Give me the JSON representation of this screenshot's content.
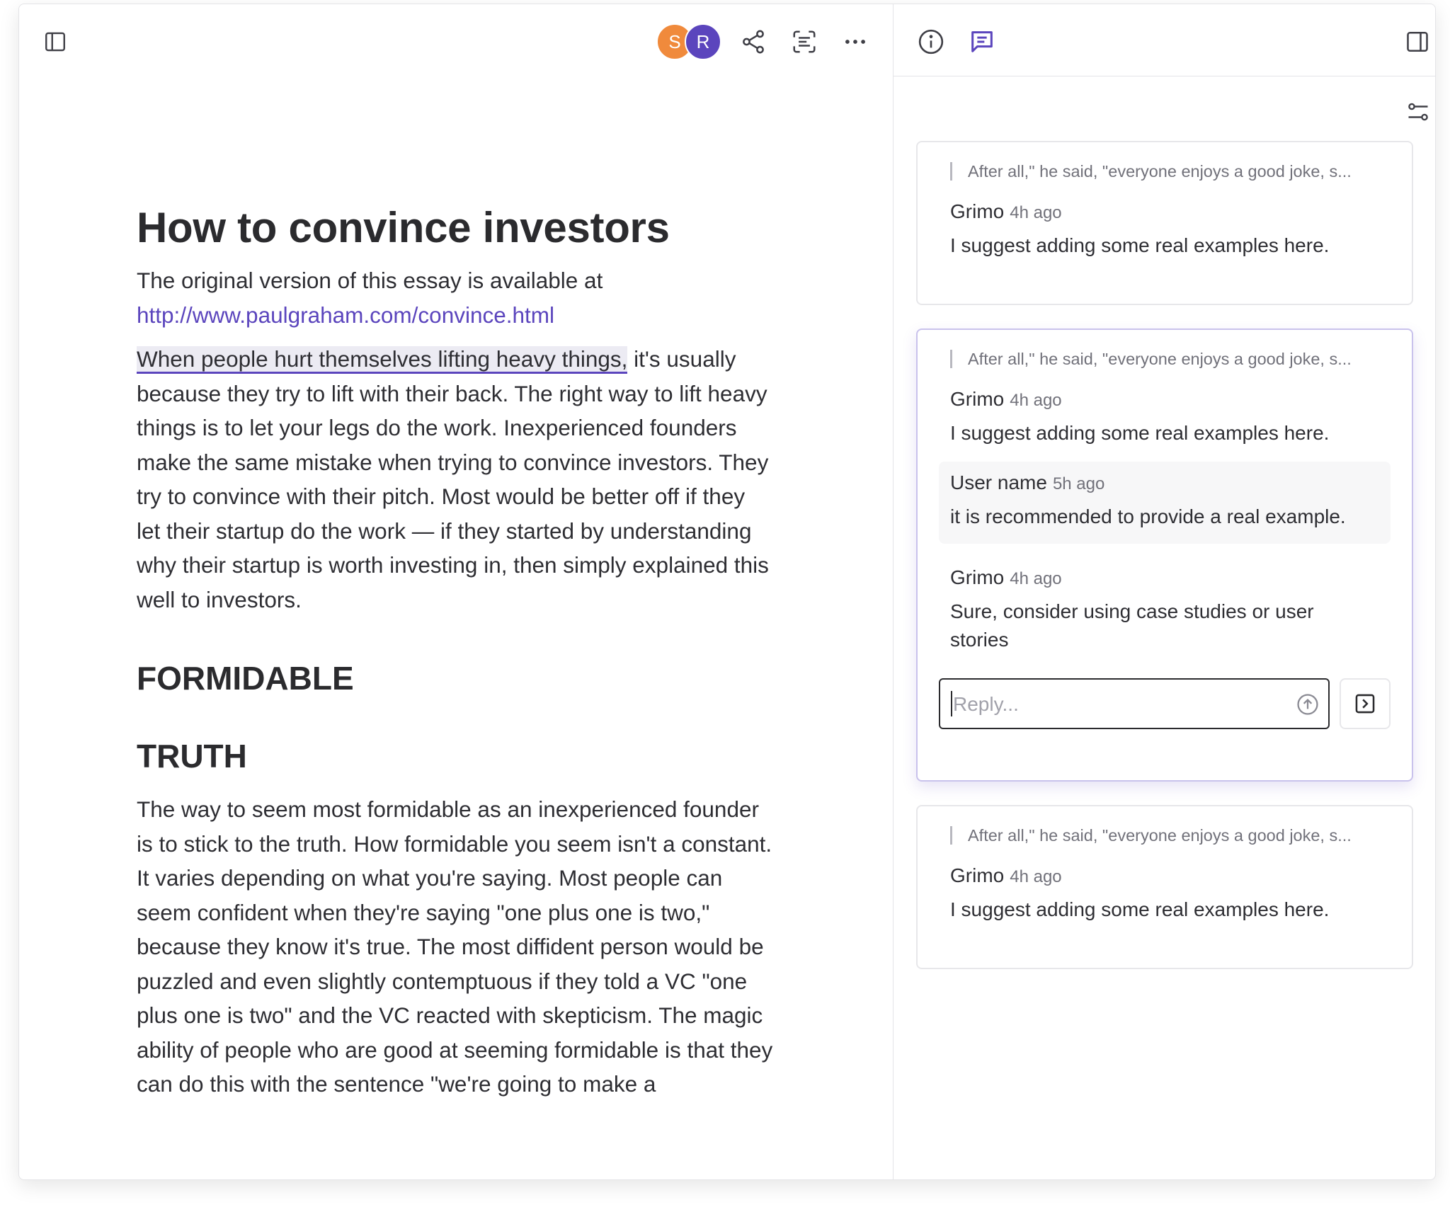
{
  "toolbar": {
    "avatars": [
      {
        "initial": "S",
        "color": "#f08a3c"
      },
      {
        "initial": "R",
        "color": "#5b45bd"
      }
    ]
  },
  "document": {
    "title": "How to convince investors",
    "intro_text": "The original version of this essay is available at ",
    "intro_link": "http://www.paulgraham.com/convince.html",
    "para1_highlight": "When people hurt themselves lifting heavy things,",
    "para1_rest": " it's usually because they try to lift with their back. The right way to lift heavy things is to let your legs do the work. Inexperienced founders make the same mistake when trying to convince investors. They try to convince with their pitch. Most would be better off if they let their startup do the work — if they started by understanding why their startup is worth investing in, then simply explained this well to investors.",
    "heading1": "FORMIDABLE",
    "heading2": "TRUTH",
    "para2": "The way to seem most formidable as an inexperienced founder is to stick to the truth. How formidable you seem isn't a constant. It varies depending on what you're saying. Most people can seem confident when they're saying \"one plus one is two,\" because they know it's true. The most diffident person would be puzzled and even slightly contemptuous if they told a VC \"one plus one is two\" and the VC reacted with skepticism. The magic ability of people who are good at seeming formidable is that they can do this with the sentence \"we're going to make a"
  },
  "comments": {
    "threads": [
      {
        "quote": "After all,\" he said, \"everyone enjoys a good joke, s...",
        "items": [
          {
            "author": "Grimo",
            "time": "4h ago",
            "text": "I suggest adding some real examples here."
          }
        ]
      },
      {
        "quote": "After all,\" he said, \"everyone enjoys a good joke, s...",
        "items": [
          {
            "author": "Grimo",
            "time": "4h ago",
            "text": "I suggest adding some real examples here."
          },
          {
            "author": "User name",
            "time": "5h ago",
            "text": "it is recommended to provide a real example."
          },
          {
            "author": "Grimo",
            "time": "4h ago",
            "text": "Sure, consider using case studies or user stories"
          }
        ],
        "reply_placeholder": "Reply..."
      },
      {
        "quote": "After all,\" he said, \"everyone enjoys a good joke, s...",
        "items": [
          {
            "author": "Grimo",
            "time": "4h ago",
            "text": "I suggest adding some real examples here."
          }
        ]
      }
    ]
  },
  "colors": {
    "accent": "#5b45bd",
    "text": "#2e2e33",
    "muted": "#71717a"
  }
}
